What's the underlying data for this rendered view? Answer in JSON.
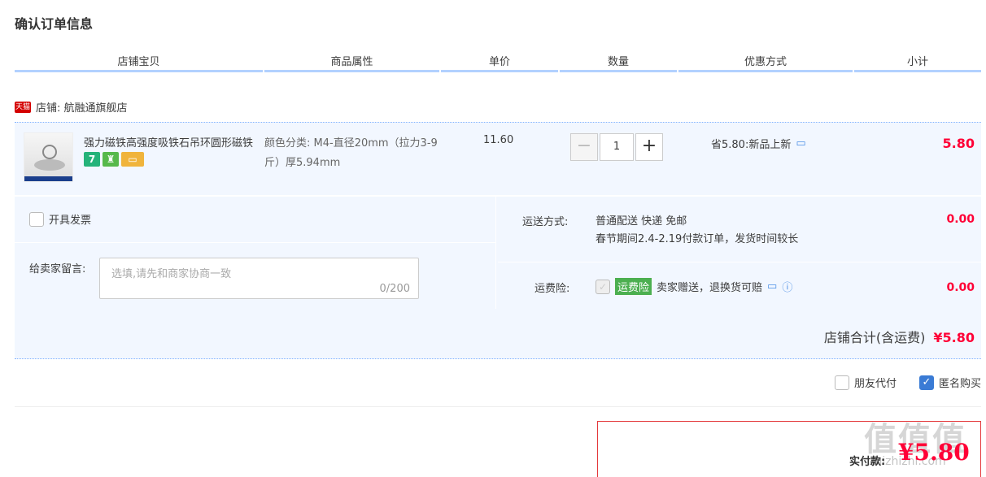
{
  "page": {
    "title": "确认订单信息"
  },
  "columns": [
    "店铺宝贝",
    "商品属性",
    "单价",
    "数量",
    "优惠方式",
    "小计"
  ],
  "shop": {
    "badge": "天猫",
    "label": "店铺: 航融通旗舰店"
  },
  "item": {
    "name": "强力磁铁高强度吸铁石吊环圆形磁铁",
    "service_icons": [
      "seven-day-return-icon",
      "shopping-bag-icon",
      "card-icon"
    ],
    "seven_label": "7",
    "props": "颜色分类: M4-直径20mm（拉力3-9斤）厚5.94mm",
    "unit_price": "11.60",
    "quantity": "1",
    "minus": "−",
    "plus": "+",
    "promo": "省5.80:新品上新",
    "subtotal": "5.80"
  },
  "invoice": {
    "label": "开具发票"
  },
  "message": {
    "label": "给卖家留言:",
    "placeholder": "选填,请先和商家协商一致",
    "counter": "0/200"
  },
  "shipping": {
    "label": "运送方式:",
    "line1": "普通配送 快递 免邮",
    "line2": "春节期间2.4-2.19付款订单，发货时间较长",
    "fee": "0.00"
  },
  "insurance": {
    "label": "运费险:",
    "badge": "运费险",
    "text": "卖家赠送，退换货可赔",
    "fee": "0.00"
  },
  "shop_total": {
    "label": "店铺合计(含运费)",
    "amount": "¥5.80"
  },
  "pay_options": {
    "friend_pay": "朋友代付",
    "anonymous": "匿名购买"
  },
  "final": {
    "label": "实付款:",
    "amount": "¥5.80"
  },
  "watermark": {
    "text": "值值值",
    "sub": "zhizhizhi.com"
  },
  "colors": {
    "accent": "#ff0036",
    "header_line": "#b2d1ff",
    "row_bg": "#f2f7ff"
  }
}
